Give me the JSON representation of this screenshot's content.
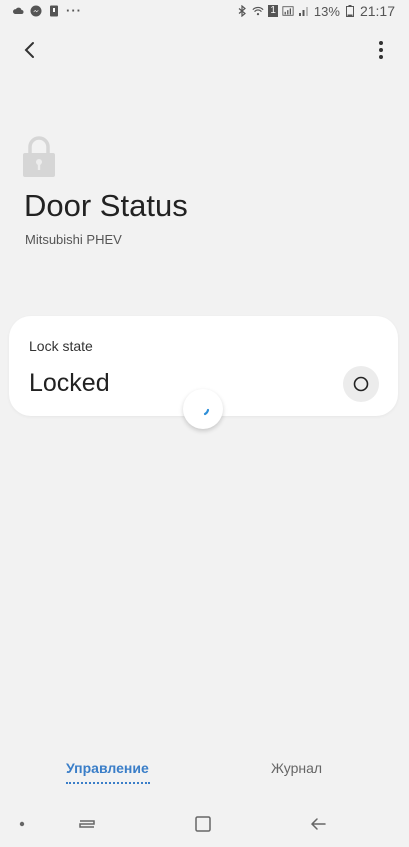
{
  "status_bar": {
    "battery_percent": "13%",
    "time": "21:17",
    "sim_label": "1",
    "more_glyph": "···"
  },
  "header": {
    "title": "Door Status",
    "subtitle": "Mitsubishi PHEV"
  },
  "lock_card": {
    "label": "Lock state",
    "value": "Locked"
  },
  "tabs": [
    {
      "label": "Управление",
      "active": true
    },
    {
      "label": "Журнал",
      "active": false
    }
  ],
  "colors": {
    "accent": "#3a7ec8",
    "background": "#f2f2f2",
    "card": "#ffffff",
    "spinner_arc": "#2f8fd8"
  },
  "icons": {
    "back": "back-arrow-icon",
    "more": "more-vert-icon",
    "lock": "padlock-icon",
    "toggle": "circle-icon",
    "loading": "loading-spinner-icon"
  }
}
